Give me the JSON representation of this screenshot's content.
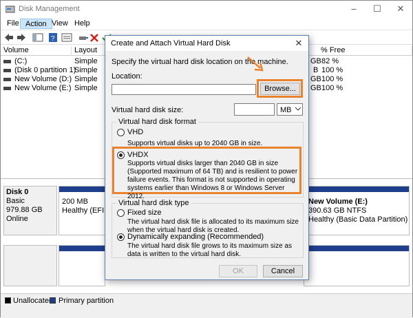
{
  "window": {
    "title": "Disk Management",
    "controls": [
      "–",
      "☐",
      "✕"
    ]
  },
  "menu": [
    {
      "label": "File"
    },
    {
      "label": "Action"
    },
    {
      "label": "View"
    },
    {
      "label": "Help"
    }
  ],
  "volume_table": {
    "columns": [
      "Volume",
      "Layout",
      "% Free"
    ],
    "rows": [
      {
        "volume": "(C:)",
        "layout": "Simple",
        "size_tail": "GB",
        "free": "82 %"
      },
      {
        "volume": "(Disk 0 partition 1)",
        "layout": "Simple",
        "size_tail": "B",
        "free": "100 %"
      },
      {
        "volume": "New Volume (D:)",
        "layout": "Simple",
        "size_tail": "GB",
        "free": "100 %"
      },
      {
        "volume": "New Volume (E:)",
        "layout": "Simple",
        "size_tail": "GB",
        "free": "100 %"
      }
    ]
  },
  "disk0": {
    "name": "Disk 0",
    "type": "Basic",
    "size": "979.88 GB",
    "status": "Online",
    "part1_size": "200 MB",
    "part1_status": "Healthy (EFI",
    "part_last_name": "New Volume (E:)",
    "part_last_size": "390.63 GB NTFS",
    "part_last_status": "Healthy (Basic Data Partition)"
  },
  "legend": {
    "unallocated": "Unallocated",
    "primary": "Primary partition"
  },
  "dialog": {
    "title": "Create and Attach Virtual Hard Disk",
    "close": "✕",
    "intro": "Specify the virtual hard disk location on the machine.",
    "location_label": "Location:",
    "location_value": "",
    "browse": "Browse...",
    "size_label": "Virtual hard disk size:",
    "size_value": "",
    "size_unit": "MB",
    "format_group": "Virtual hard disk format",
    "vhd_label": "VHD",
    "vhd_desc": "Supports virtual disks up to 2040 GB in size.",
    "vhdx_label": "VHDX",
    "vhdx_desc": "Supports virtual disks larger than 2040 GB in size (Supported maximum of 64 TB) and is resilient to power failure events. This format is not supported in operating systems earlier than Windows 8 or Windows Server 2012.",
    "type_group": "Virtual hard disk type",
    "fixed_label": "Fixed size",
    "fixed_desc": "The virtual hard disk file is allocated to its maximum size when the virtual hard disk is created.",
    "dynamic_label": "Dynamically expanding (Recommended)",
    "dynamic_desc": "The virtual hard disk file grows to its maximum size as data is written to the virtual hard disk.",
    "ok": "OK",
    "cancel": "Cancel",
    "selected_format": "VHDX",
    "selected_type": "Dynamically expanding (Recommended)"
  },
  "colors": {
    "highlight": "#e9832d",
    "partition_bar": "#1f3e8c",
    "unallocated": "#000000"
  }
}
